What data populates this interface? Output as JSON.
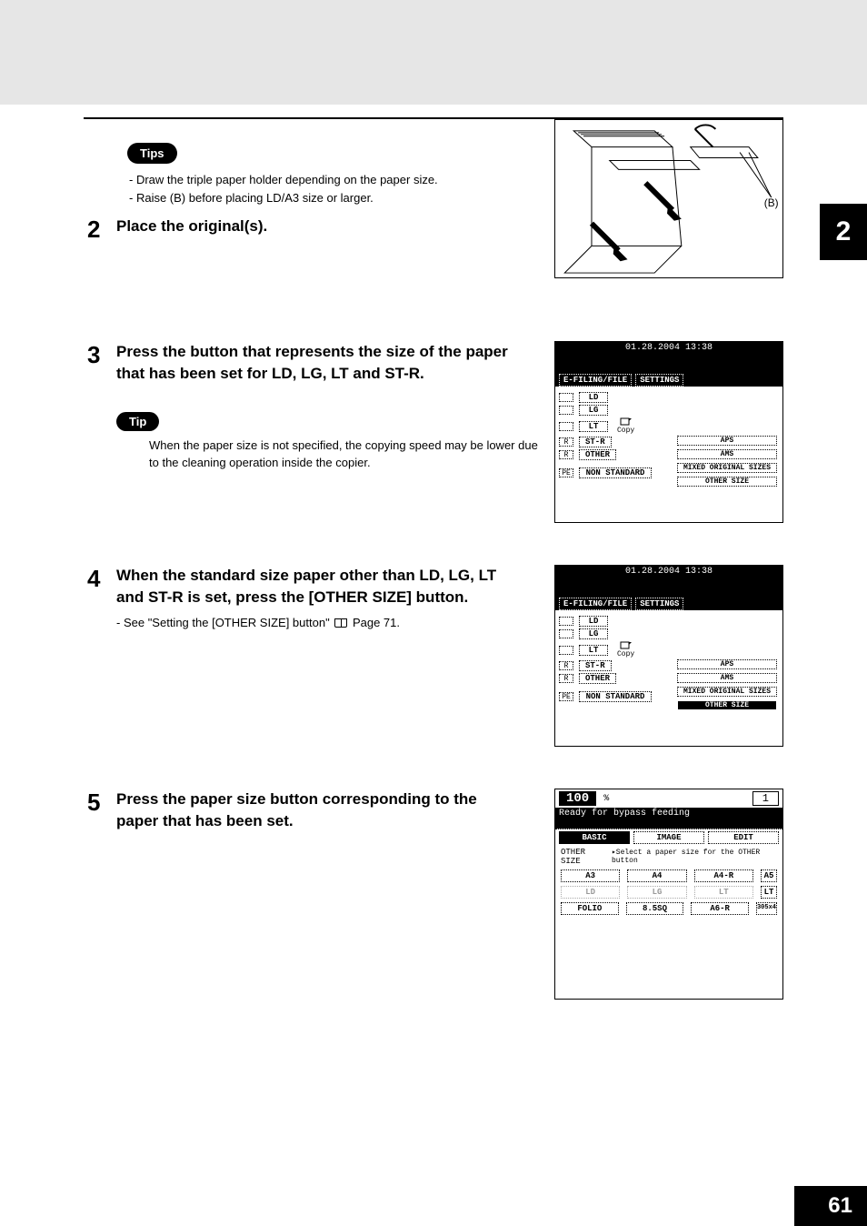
{
  "chapterTab": "2",
  "pageNumber": "61",
  "tipsPill": "Tips",
  "tipPill": "Tip",
  "tipsList": [
    "Draw the triple paper holder depending on the paper size.",
    "Raise (B) before placing LD/A3 size or larger."
  ],
  "steps": {
    "s2": {
      "num": "2",
      "title": "Place the original(s)."
    },
    "s3": {
      "num": "3",
      "title": "Press the button that represents the size of the paper that has been set for LD, LG, LT and ST-R.",
      "tip": "When the paper size is not specified, the copying speed may be lower due to the cleaning operation inside the copier."
    },
    "s4": {
      "num": "4",
      "title": "When the standard size paper other than LD, LG, LT and ST-R is set, press the [OTHER SIZE] button.",
      "ref": "See \"Setting the [OTHER SIZE] button\"",
      "refPage": "Page 71."
    },
    "s5": {
      "num": "5",
      "title": "Press the paper size button corresponding to the paper that has been set."
    }
  },
  "illus": {
    "bLabel": "(B)"
  },
  "panel": {
    "datetime": "01.28.2004 13:38",
    "tabs": {
      "efiling": "E-FILING/FILE",
      "settings": "SETTINGS"
    },
    "slots": {
      "r": "R",
      "pe": "PE"
    },
    "sizes": {
      "ld": "LD",
      "lg": "LG",
      "lt": "LT",
      "str": "ST-R",
      "other": "OTHER",
      "nonstd": "NON STANDARD"
    },
    "right": {
      "aps": "APS",
      "ams": "AMS",
      "mixed": "MIXED ORIGINAL SIZES",
      "othersize": "OTHER SIZE"
    },
    "copy": "Copy"
  },
  "panel5": {
    "pct": "100",
    "pctSign": "%",
    "count": "1",
    "status": "Ready for bypass feeding",
    "tabs": {
      "basic": "BASIC",
      "image": "IMAGE",
      "edit": "EDIT"
    },
    "othersize": "OTHER SIZE",
    "prompt": "Select a paper size for the OTHER button",
    "row1": {
      "a3": "A3",
      "a4": "A4",
      "a4r": "A4-R",
      "a5": "A5"
    },
    "row2": {
      "ld": "LD",
      "lg": "LG",
      "lt": "LT",
      "ltr": "LT"
    },
    "row3": {
      "folio": "FOLIO",
      "85sq": "8.5SQ",
      "a6r": "A6-R",
      "last": "305x4"
    }
  }
}
